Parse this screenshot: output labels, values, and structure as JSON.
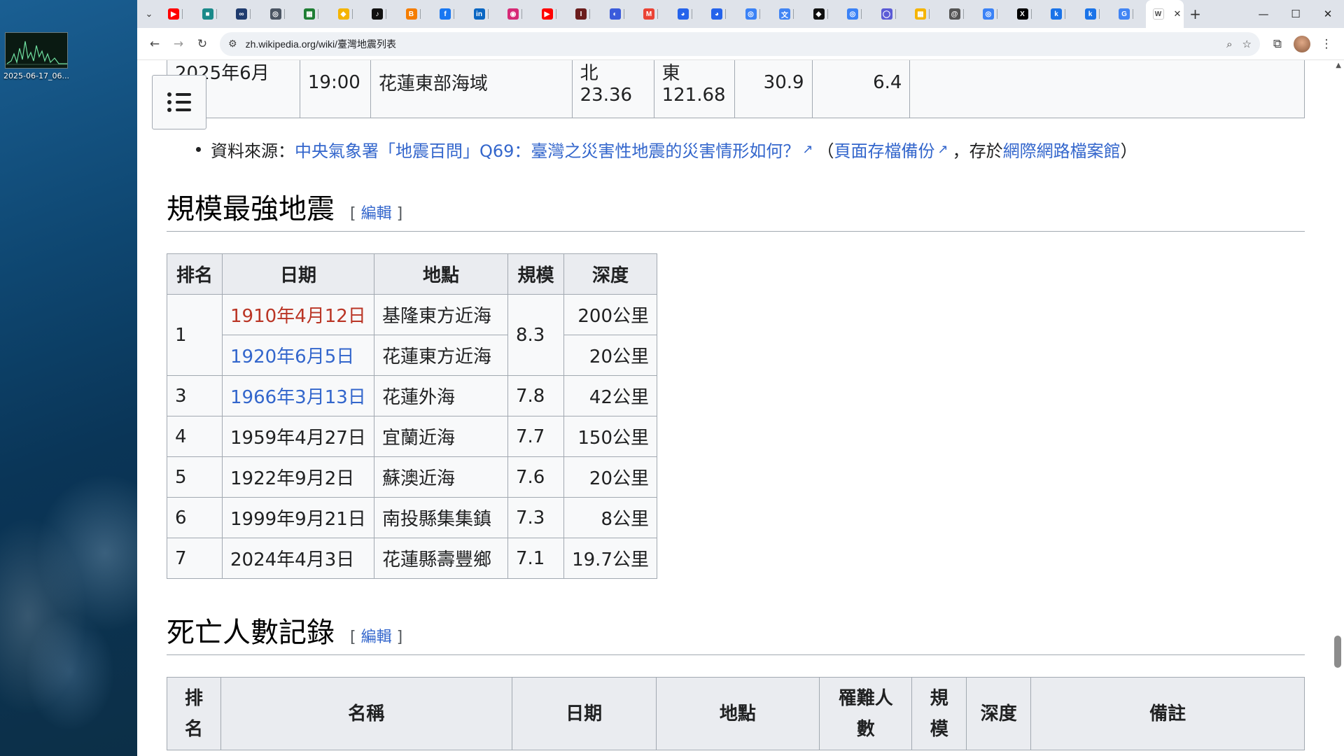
{
  "desktop": {
    "icon_label": "2025-06-17_06..."
  },
  "browser": {
    "tab_count": 30,
    "active_tab_close": "✕",
    "new_tab": "+",
    "url": "zh.wikipedia.org/wiki/臺灣地震列表"
  },
  "tabs": [
    {
      "icon": "youtube-icon",
      "color": "#ff0000",
      "glyph": "▶"
    },
    {
      "icon": "app-icon",
      "color": "#1a8a8a",
      "glyph": "■"
    },
    {
      "icon": "link-icon",
      "color": "#1f3b6e",
      "glyph": "∞"
    },
    {
      "icon": "chatgpt-icon",
      "color": "#4b5563",
      "glyph": "◎"
    },
    {
      "icon": "sheets-icon",
      "color": "#1e7e34",
      "glyph": "▦"
    },
    {
      "icon": "slides-icon",
      "color": "#f4b400",
      "glyph": "◆"
    },
    {
      "icon": "tiktok-icon",
      "color": "#111111",
      "glyph": "♪"
    },
    {
      "icon": "blogger-icon",
      "color": "#f57d00",
      "glyph": "B"
    },
    {
      "icon": "facebook-icon",
      "color": "#1877f2",
      "glyph": "f"
    },
    {
      "icon": "linkedin-icon",
      "color": "#0a66c2",
      "glyph": "in"
    },
    {
      "icon": "instagram-icon",
      "color": "#d62976",
      "glyph": "◉"
    },
    {
      "icon": "youtube-icon",
      "color": "#ff0000",
      "glyph": "▶"
    },
    {
      "icon": "imdb-icon",
      "color": "#6b1d1d",
      "glyph": "I"
    },
    {
      "icon": "chat-icon",
      "color": "#3b5bdb",
      "glyph": "◐"
    },
    {
      "icon": "gmail-icon",
      "color": "#ea4335",
      "glyph": "M"
    },
    {
      "icon": "copilot-icon",
      "color": "#2563eb",
      "glyph": "◕"
    },
    {
      "icon": "copilot-icon",
      "color": "#2563eb",
      "glyph": "◕"
    },
    {
      "icon": "chatgpt-icon",
      "color": "#3b82f6",
      "glyph": "◎"
    },
    {
      "icon": "translate-icon",
      "color": "#4285f4",
      "glyph": "文"
    },
    {
      "icon": "copilot-icon",
      "color": "#111111",
      "glyph": "◆"
    },
    {
      "icon": "chatgpt-icon",
      "color": "#3b82f6",
      "glyph": "◎"
    },
    {
      "icon": "ring-icon",
      "color": "#5b5bd6",
      "glyph": "◯"
    },
    {
      "icon": "grid-icon",
      "color": "#f5b400",
      "glyph": "▦"
    },
    {
      "icon": "at-icon",
      "color": "#555555",
      "glyph": "@"
    },
    {
      "icon": "chatgpt-icon",
      "color": "#3b82f6",
      "glyph": "◎"
    },
    {
      "icon": "x-icon",
      "color": "#000000",
      "glyph": "X"
    },
    {
      "icon": "k-icon",
      "color": "#1a73e8",
      "glyph": "k"
    },
    {
      "icon": "k-icon",
      "color": "#1a73e8",
      "glyph": "k"
    },
    {
      "icon": "google-icon",
      "color": "#4285f4",
      "glyph": "G"
    }
  ],
  "prev_row": {
    "date": "2025年6月11",
    "time": "19:00",
    "location": "花蓮東部海域",
    "lat": "北23.36",
    "lon": "東121.68",
    "depth": "30.9",
    "magnitude": "6.4"
  },
  "source": {
    "prefix": "資料來源：",
    "link1": "中央氣象署「地震百問」Q69：臺灣之災害性地震的災害情形如何？",
    "open_paren": "（",
    "link2": "頁面存檔備份",
    "mid": "，存於",
    "link3": "網際網路檔案館",
    "close_paren": "）"
  },
  "section_strongest": {
    "title": "規模最強地震",
    "edit": "編輯",
    "bracket_open": "[",
    "bracket_close": "]"
  },
  "strongest_table": {
    "headers": [
      "排名",
      "日期",
      "地點",
      "規模",
      "深度"
    ],
    "rows": [
      {
        "rank": "1",
        "date": "1910年4月12日",
        "place": "基隆東方近海",
        "mag": "8.3",
        "depth": "200公里"
      },
      {
        "rank": "",
        "date": "1920年6月5日",
        "place": "花蓮東方近海",
        "mag": "",
        "depth": "20公里"
      },
      {
        "rank": "3",
        "date": "1966年3月13日",
        "place": "花蓮外海",
        "mag": "7.8",
        "depth": "42公里"
      },
      {
        "rank": "4",
        "date": "1959年4月27日",
        "place": "宜蘭近海",
        "mag": "7.7",
        "depth": "150公里"
      },
      {
        "rank": "5",
        "date": "1922年9月2日",
        "place": "蘇澳近海",
        "mag": "7.6",
        "depth": "20公里"
      },
      {
        "rank": "6",
        "date": "1999年9月21日",
        "place": "南投縣集集鎮",
        "mag": "7.3",
        "depth": "8公里"
      },
      {
        "rank": "7",
        "date": "2024年4月3日",
        "place": "花蓮縣壽豐鄉",
        "mag": "7.1",
        "depth": "19.7公里"
      }
    ]
  },
  "section_deaths": {
    "title": "死亡人數記錄",
    "edit": "編輯",
    "bracket_open": "[",
    "bracket_close": "]"
  },
  "death_table": {
    "headers": [
      "排名",
      "名稱",
      "日期",
      "地點",
      "罹難人數",
      "規模",
      "深度",
      "備註"
    ]
  }
}
